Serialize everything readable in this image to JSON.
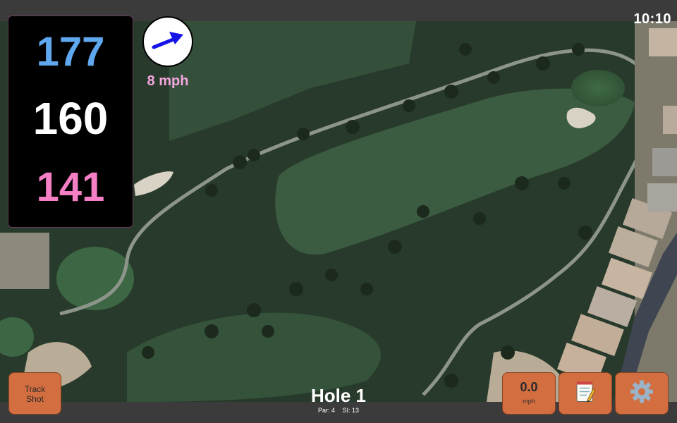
{
  "status_bar": {
    "time": "10:10"
  },
  "distances": {
    "back": "177",
    "middle": "160",
    "front": "141",
    "colors": {
      "back": "#5fa8f0",
      "middle": "#ffffff",
      "front": "#f57fc4"
    }
  },
  "wind": {
    "speed_label": "8 mph",
    "icon": "wind-direction-arrow-icon"
  },
  "hole": {
    "title": "Hole 1",
    "par_label": "Par: 4",
    "si_label": "SI: 13"
  },
  "buttons": {
    "track_shot_label": "Track\nShot",
    "speed_value": "0.0",
    "speed_unit": "mph",
    "notes_icon": "notepad-icon",
    "settings_icon": "gear-icon"
  },
  "colors": {
    "accent_button": "#d26e40",
    "background_bar": "#3b3b3b"
  }
}
